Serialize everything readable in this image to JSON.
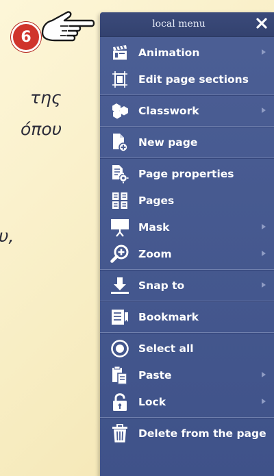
{
  "background": {
    "lines": [
      "της",
      "όπου",
      "υ,"
    ]
  },
  "step_badge": "6",
  "menu": {
    "title": "local menu",
    "sections": [
      {
        "items": [
          {
            "label": "Animation",
            "icon": "animation-clapper-icon",
            "submenu": true
          },
          {
            "label": "Edit page sections",
            "icon": "page-sections-icon",
            "submenu": false
          }
        ]
      },
      {
        "items": [
          {
            "label": "Classwork",
            "icon": "classwork-hexagons-icon",
            "submenu": true
          }
        ]
      },
      {
        "items": [
          {
            "label": "New page",
            "icon": "new-page-icon",
            "submenu": false
          }
        ]
      },
      {
        "items": [
          {
            "label": "Page properties",
            "icon": "page-properties-icon",
            "submenu": false
          },
          {
            "label": "Pages",
            "icon": "pages-grid-icon",
            "submenu": false
          },
          {
            "label": "Mask",
            "icon": "mask-screen-icon",
            "submenu": true
          },
          {
            "label": "Zoom",
            "icon": "zoom-icon",
            "submenu": true
          }
        ]
      },
      {
        "items": [
          {
            "label": "Snap to",
            "icon": "snap-to-icon",
            "submenu": true
          }
        ]
      },
      {
        "items": [
          {
            "label": "Bookmark",
            "icon": "bookmark-icon",
            "submenu": false
          }
        ]
      },
      {
        "items": [
          {
            "label": "Select all",
            "icon": "select-all-icon",
            "submenu": false
          },
          {
            "label": "Paste",
            "icon": "paste-icon",
            "submenu": true
          },
          {
            "label": "Lock",
            "icon": "lock-icon",
            "submenu": true
          }
        ]
      },
      {
        "items": [
          {
            "label": "Delete from the page",
            "icon": "trash-icon",
            "submenu": false
          }
        ]
      }
    ]
  },
  "colors": {
    "menu_bg": "#4a5d93",
    "header_bg": "#36456f",
    "badge_red": "#d0342c"
  }
}
